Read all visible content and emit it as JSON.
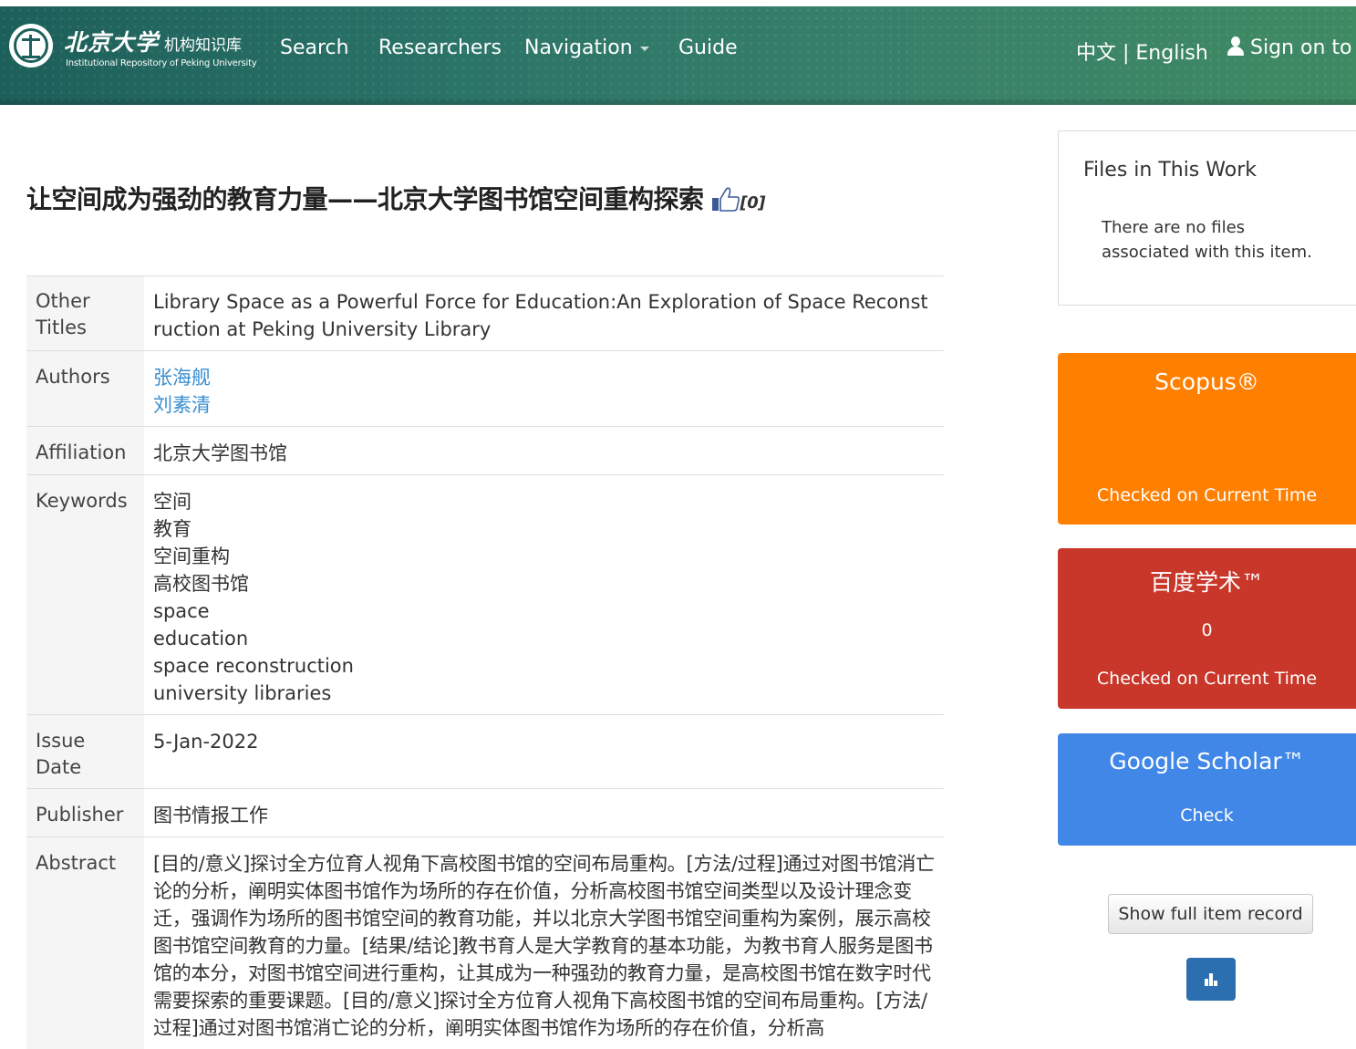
{
  "header": {
    "logo_cn": "北京大学",
    "logo_cn_sub": "机构知识库",
    "logo_en": "Institutional Repository of Peking University",
    "nav": {
      "search": "Search",
      "researchers": "Researchers",
      "navigation": "Navigation",
      "guide": "Guide"
    },
    "language": "中文 | English",
    "signon": "Sign on to"
  },
  "item": {
    "title": "让空间成为强劲的教育力量——北京大学图书馆空间重构探索",
    "like_count": "[0]",
    "fields": {
      "other_titles_label": "Other Titles",
      "other_titles": "Library Space as a Powerful Force for Education:An Exploration of Space Reconstruction at Peking University Library",
      "authors_label": "Authors",
      "authors": [
        "张海舰",
        "刘素清"
      ],
      "affiliation_label": "Affiliation",
      "affiliation": "北京大学图书馆",
      "keywords_label": "Keywords",
      "keywords": [
        "空间",
        "教育",
        "空间重构",
        "高校图书馆",
        "space",
        "education",
        "space reconstruction",
        "university libraries"
      ],
      "issue_date_label": "Issue Date",
      "issue_date": "5-Jan-2022",
      "publisher_label": "Publisher",
      "publisher": "图书情报工作",
      "abstract_label": "Abstract",
      "abstract": "[目的/意义]探讨全方位育人视角下高校图书馆的空间布局重构。[方法/过程]通过对图书馆消亡论的分析，阐明实体图书馆作为场所的存在价值，分析高校图书馆空间类型以及设计理念变迁，强调作为场所的图书馆空间的教育功能，并以北京大学图书馆空间重构为案例，展示高校图书馆空间教育的力量。[结果/结论]教书育人是大学教育的基本功能，为教书育人服务是图书馆的本分，对图书馆空间进行重构，让其成为一种强劲的教育力量，是高校图书馆在数字时代需要探索的重要课题。[目的/意义]探讨全方位育人视角下高校图书馆的空间布局重构。[方法/过程]通过对图书馆消亡论的分析，阐明实体图书馆作为场所的存在价值，分析高"
    }
  },
  "sidebar": {
    "files_title": "Files in This Work",
    "files_text": "There are no files associated with this item.",
    "scopus": {
      "name": "Scopus®",
      "status": "Checked on Current Time",
      "color": "#ff7f00"
    },
    "baidu": {
      "name": "百度学术™",
      "value": "0",
      "status": "Checked on Current Time",
      "color": "#c9362a"
    },
    "google": {
      "name": "Google Scholar™",
      "status": "Check",
      "color": "#4087e8"
    },
    "full_record_button": "Show full item record",
    "stats_icon": "bar-chart-icon"
  }
}
